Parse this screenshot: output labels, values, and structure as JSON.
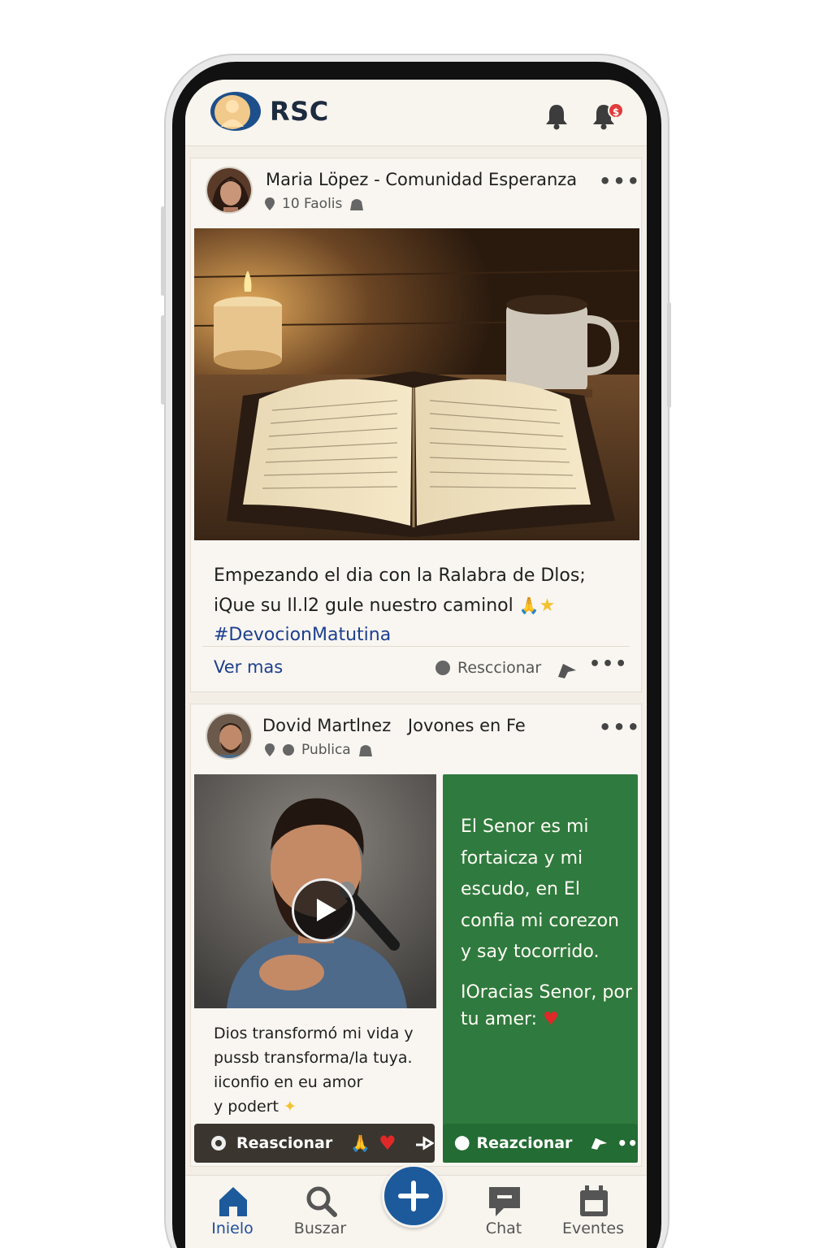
{
  "app": {
    "title": "RSC",
    "notification_badge": "$"
  },
  "posts": [
    {
      "author": "Maria Löpez - Comunidad Esperanza",
      "meta": "10 Faolis",
      "caption_line1": "Empezando el dia con la Ralabra de Dlos;",
      "caption_line2": "iQue su Il.l2 gule nuestro caminol",
      "hashtag": "#DevocionMatutina",
      "ver_mas": "Ver mas",
      "react_label": "Resccionar"
    },
    {
      "author": "Dovid Martlnez",
      "group": "Jovones en Fe",
      "meta": "Publica",
      "video_caption_line1": "Dios transf‌ormó mi vida y",
      "video_caption_line2": "pussb transforma/la tuya.",
      "video_caption_line3": "iiconfio en eu amor",
      "video_caption_line4": "y podert",
      "verse_line1": "El Senor es mi",
      "verse_line2": "fortaicza y mi",
      "verse_line3": "escudo, en El",
      "verse_line4": "confia mi corezon",
      "verse_line5": "y say tocorrido.",
      "verse_line6": "IOracias Senor, por",
      "verse_line7": "tu amer:",
      "react_left": "Reascionar",
      "react_right": "Reazcionar"
    }
  ],
  "nav": [
    {
      "label": "Inielo",
      "icon": "home-icon",
      "active": true
    },
    {
      "label": "Buszar",
      "icon": "search-icon",
      "active": false
    },
    {
      "label": "",
      "icon": "plus-icon",
      "active": false
    },
    {
      "label": "Chat",
      "icon": "chat-icon",
      "active": false
    },
    {
      "label": "Eventes",
      "icon": "calendar-icon",
      "active": false
    }
  ],
  "colors": {
    "accent": "#1d5a9c",
    "verse_bg": "#2f7a3e",
    "hashtag": "#1d3f8e"
  }
}
